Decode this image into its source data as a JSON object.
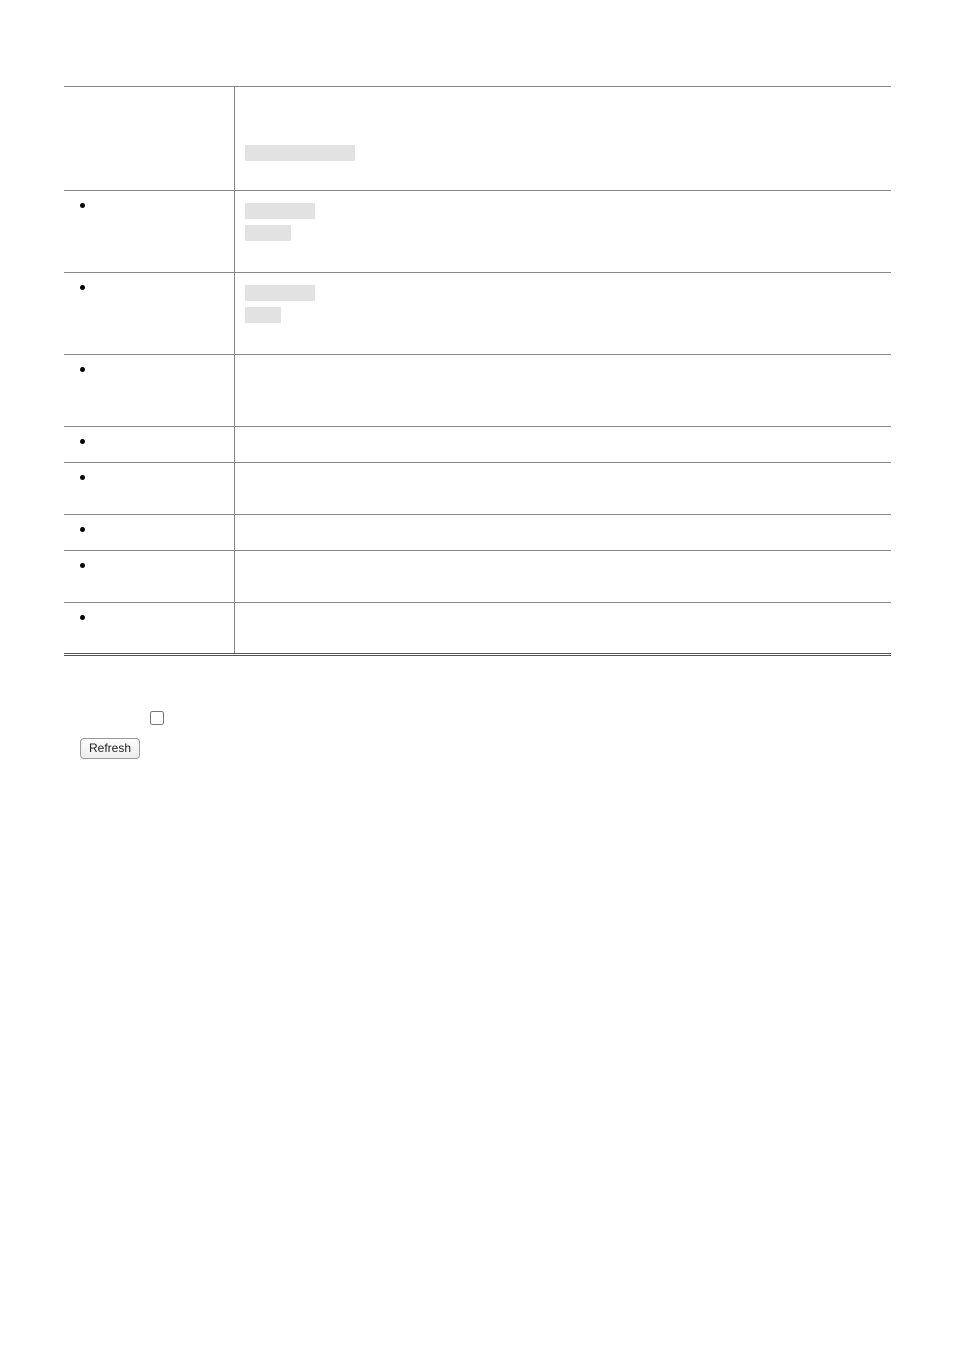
{
  "controls": {
    "checkbox_checked": false,
    "refresh_label": "Refresh"
  }
}
